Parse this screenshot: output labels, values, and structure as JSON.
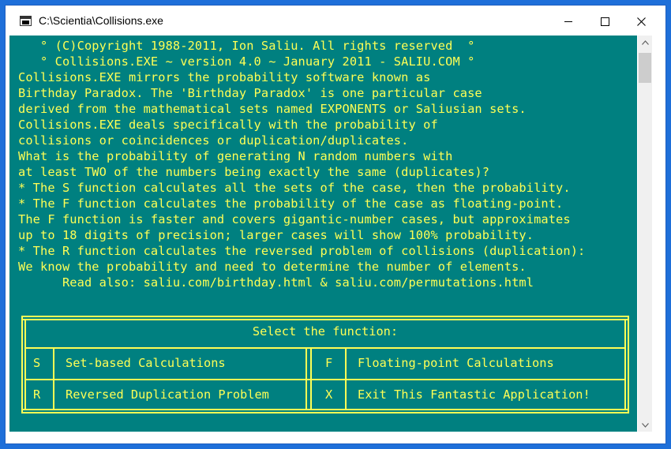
{
  "window": {
    "title": "C:\\Scientia\\Collisions.exe",
    "icon": "console-app-icon",
    "controls": [
      "minimize-icon",
      "maximize-icon",
      "close-icon"
    ]
  },
  "colors": {
    "console_bg": "#008080",
    "console_text": "#ffff55",
    "desktop_border": "#1e6fd9"
  },
  "console": {
    "lines": [
      "   ° (C)Copyright 1988-2011, Ion Saliu. All rights reserved  °",
      "   ° Collisions.EXE ~ version 4.0 ~ January 2011 - SALIU.COM °",
      "Collisions.EXE mirrors the probability software known as",
      "Birthday Paradox. The 'Birthday Paradox' is one particular case",
      "derived from the mathematical sets named EXPONENTS or Saliusian sets.",
      "Collisions.EXE deals specifically with the probability of",
      "collisions or coincidences or duplication/duplicates.",
      "What is the probability of generating N random numbers with",
      "at least TWO of the numbers being exactly the same (duplicates)?",
      "* The S function calculates all the sets of the case, then the probability.",
      "* The F function calculates the probability of the case as floating-point.",
      "The F function is faster and covers gigantic-number cases, but approximates",
      "up to 18 digits of precision; larger cases will show 100% probability.",
      "* The R function calculates the reversed problem of collisions (duplication):",
      "We know the probability and need to determine the number of elements.",
      "      Read also: saliu.com/birthday.html & saliu.com/permutations.html"
    ]
  },
  "menu": {
    "title": "Select the function:",
    "options": [
      {
        "key": "S",
        "label": "Set-based Calculations"
      },
      {
        "key": "F",
        "label": "Floating-point Calculations"
      },
      {
        "key": "R",
        "label": "Reversed Duplication Problem"
      },
      {
        "key": "X",
        "label": "Exit This Fantastic Application!"
      }
    ]
  }
}
